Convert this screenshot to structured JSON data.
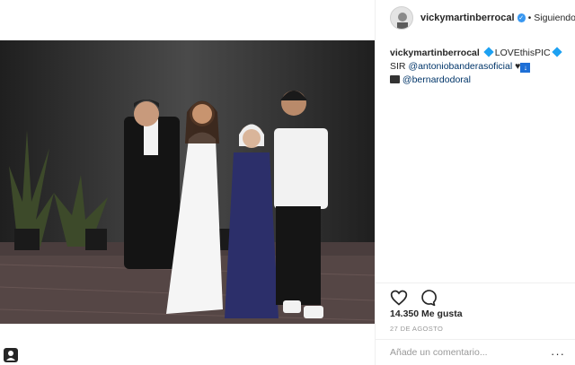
{
  "post": {
    "username": "vickymartinberrocal",
    "follow_separator": "•",
    "follow_label": "Siguiendo",
    "caption": {
      "username": "vickymartinberrocal",
      "love_text": "LOVEthisPIC",
      "sir_text": "SIR",
      "mention_1": "@antoniobanderasoficial",
      "heart": "♥",
      "mention_2": "@bernardodoral"
    },
    "likes_text": "14.350 Me gusta",
    "date_text": "27 DE AGOSTO",
    "comment_placeholder": "Añade un comentario...",
    "more_options": "···"
  },
  "colors": {
    "verified_badge": "#3897f0",
    "mention": "#003569",
    "photo_background": "#2b2b2b"
  },
  "icons": [
    "verified-icon",
    "heart-icon",
    "comment-icon",
    "user-tag-icon",
    "more-options-icon"
  ]
}
